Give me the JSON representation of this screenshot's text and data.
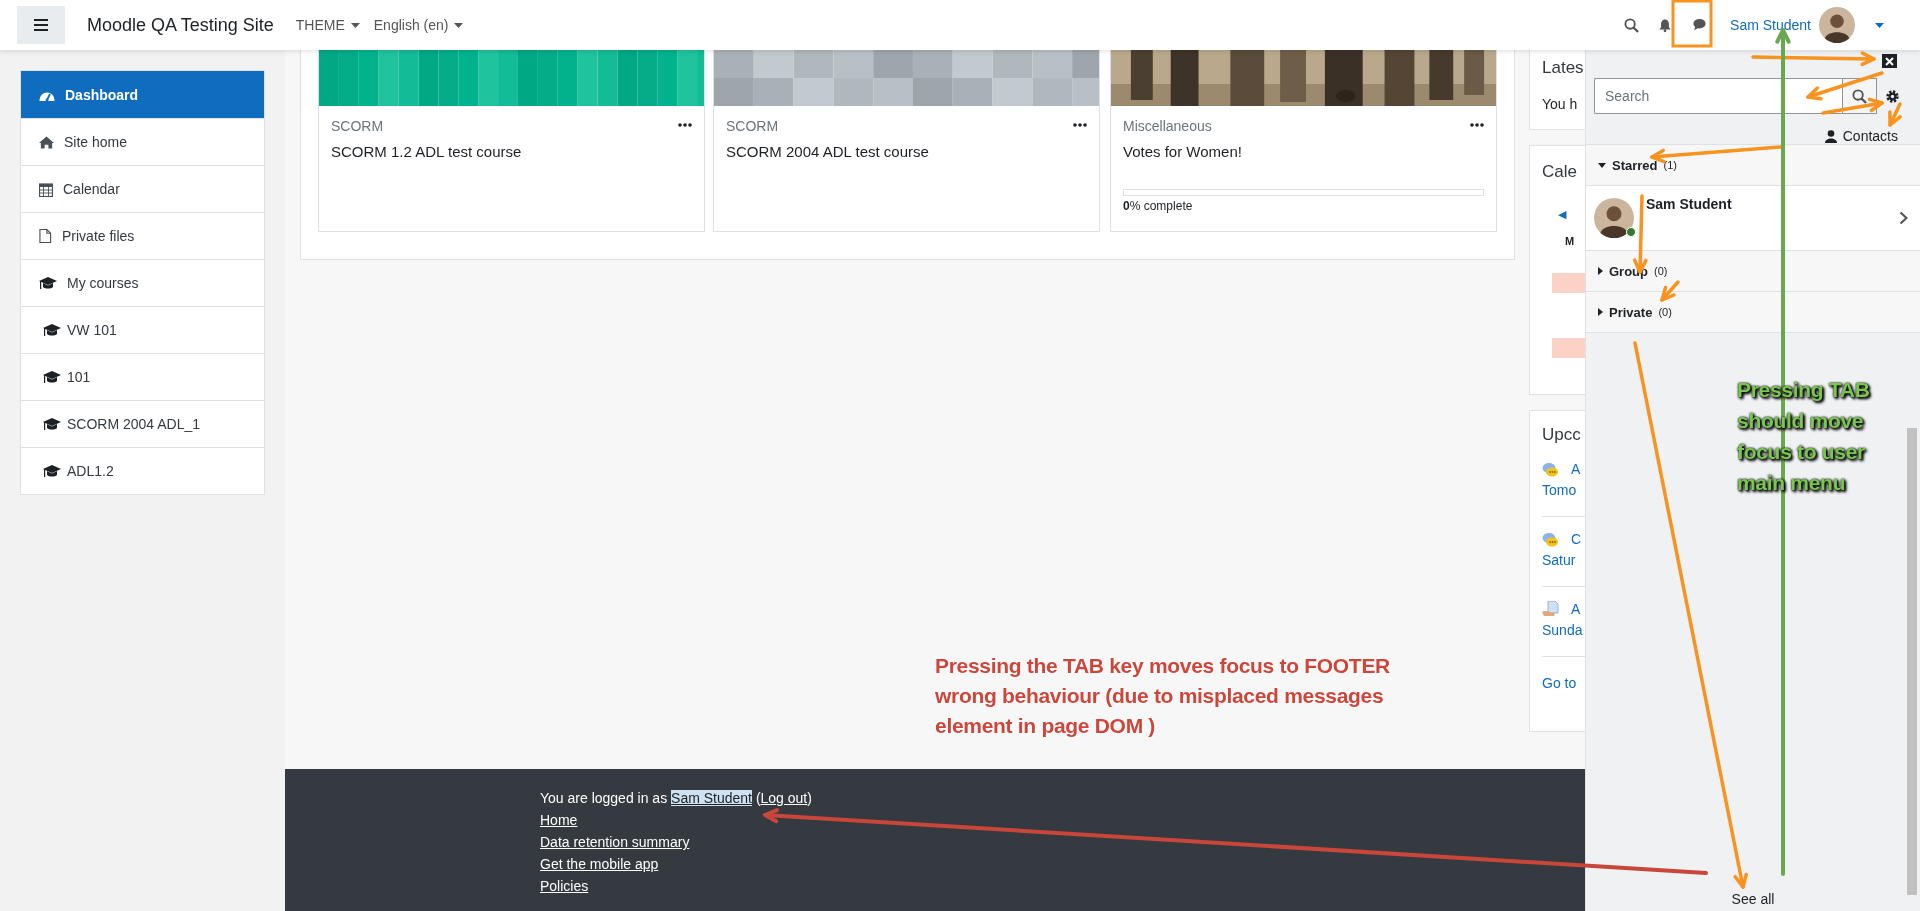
{
  "topbar": {
    "site_name": "Moodle QA Testing Site",
    "menus": [
      {
        "label": "THEME"
      },
      {
        "label": "English (en)"
      }
    ],
    "user_name": "Sam Student"
  },
  "nav": [
    {
      "label": "Dashboard",
      "selected": true
    },
    {
      "label": "Site home",
      "selected": false
    },
    {
      "label": "Calendar",
      "selected": false
    },
    {
      "label": "Private files",
      "selected": false
    },
    {
      "label": "My courses",
      "selected": false,
      "children": [
        {
          "label": "VW 101",
          "selected": false
        },
        {
          "label": "101",
          "selected": false
        },
        {
          "label": "SCORM 2004 ADL_1",
          "selected": false
        },
        {
          "label": "ADL1.2",
          "selected": false
        }
      ]
    }
  ],
  "courses": [
    {
      "category": "SCORM",
      "title": "SCORM 1.2 ADL test course"
    },
    {
      "category": "SCORM",
      "title": "SCORM 2004 ADL test course"
    },
    {
      "category": "Miscellaneous",
      "title": "Votes for Women!",
      "progress": {
        "level": 0,
        "label": "**0**% complete"
      }
    }
  ],
  "blocks": {
    "latest": {
      "title": "Lates",
      "text": "You h"
    },
    "calendar": {
      "title": "Cale",
      "prev": "◀",
      "weekday": "M"
    },
    "upcoming": {
      "title": "Upcc",
      "events": [
        {
          "kind": "chat",
          "name": "A",
          "date": "Tomo"
        },
        {
          "kind": "chat",
          "name": "C",
          "date": "Satur"
        },
        {
          "kind": "document",
          "name": "A",
          "date": "Sunda"
        }
      ],
      "link": "Go to"
    }
  },
  "messages_drawer": {
    "search_placeholder": "Search",
    "contacts_label": "Contacts",
    "sections": [
      {
        "label": "Starred",
        "count": "(1)",
        "expanded": true,
        "contacts": [
          {
            "name": "Sam Student",
            "online": true
          }
        ]
      },
      {
        "label": "Group",
        "count": "(0)",
        "expanded": false
      },
      {
        "label": "Private",
        "count": "(0)",
        "expanded": false
      }
    ],
    "see_all": "See all"
  },
  "footer": {
    "prefix": "You are logged in as",
    "user_link": "Sam Student",
    "user_focused": true,
    "open_paren": "(",
    "logout_link": "Log out",
    "close_paren": ")",
    "links": [
      "Home",
      "Data retention summary",
      "Get the mobile app",
      "Policies"
    ]
  },
  "annotations": [
    {
      "lines": [
        "Pressing the TAB key moves focus to FOOTER",
        "wrong behaviour (due to misplaced messages",
        "element in page DOM )"
      ],
      "color": "#d0453a"
    },
    {
      "lines": [
        "Pressing TAB",
        "should move",
        "focus to user",
        "main menu"
      ],
      "color": "#7ac74f"
    }
  ]
}
